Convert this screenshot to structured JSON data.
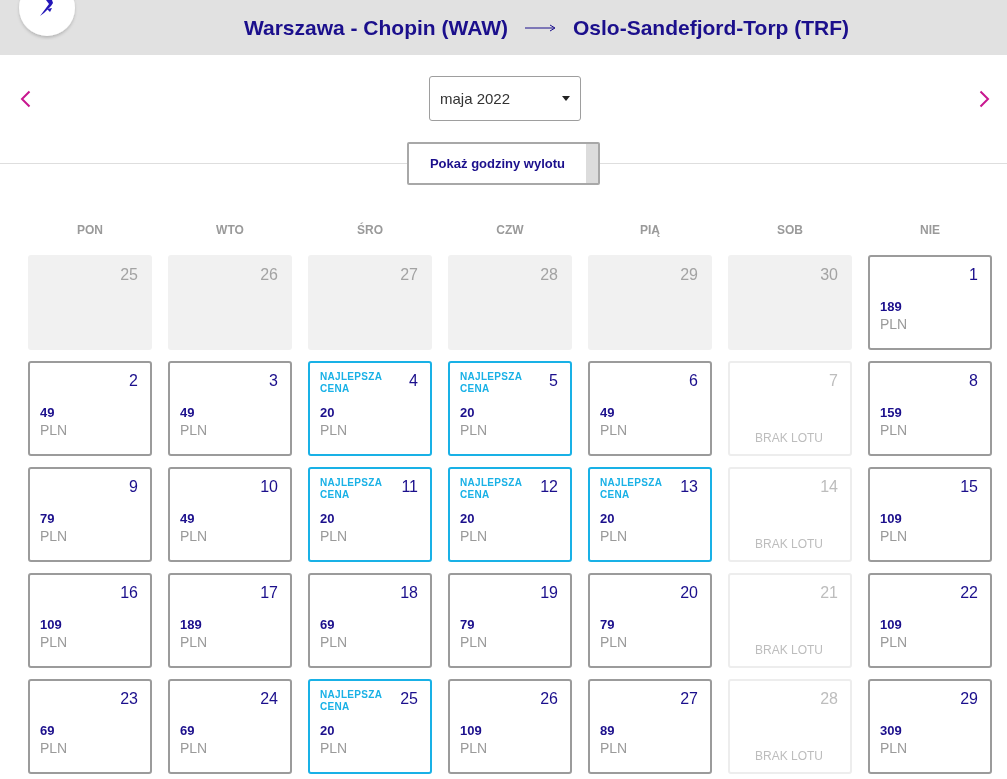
{
  "header": {
    "origin": "Warszawa - Chopin (WAW)",
    "destination": "Oslo-Sandefjord-Torp (TRF)"
  },
  "month_nav": {
    "month_select": {
      "value": "maja 2022"
    }
  },
  "show_times_button": {
    "label": "Pokaż godziny wylotu"
  },
  "calendar": {
    "weekdays": [
      "PON",
      "WTO",
      "ŚRO",
      "CZW",
      "PIĄ",
      "SOB",
      "NIE"
    ],
    "days": [
      {
        "kind": "outside",
        "date": "25"
      },
      {
        "kind": "outside",
        "date": "26"
      },
      {
        "kind": "outside",
        "date": "27"
      },
      {
        "kind": "outside",
        "date": "28"
      },
      {
        "kind": "outside",
        "date": "29"
      },
      {
        "kind": "outside",
        "date": "30"
      },
      {
        "kind": "available",
        "date": "1",
        "price": "189",
        "currency": "PLN"
      },
      {
        "kind": "available",
        "date": "2",
        "price": "49",
        "currency": "PLN"
      },
      {
        "kind": "available",
        "date": "3",
        "price": "49",
        "currency": "PLN"
      },
      {
        "kind": "best",
        "date": "4",
        "badge": "NAJLEPSZA CENA",
        "price": "20",
        "currency": "PLN"
      },
      {
        "kind": "best",
        "date": "5",
        "badge": "NAJLEPSZA CENA",
        "price": "20",
        "currency": "PLN"
      },
      {
        "kind": "available",
        "date": "6",
        "price": "49",
        "currency": "PLN"
      },
      {
        "kind": "no_flight",
        "date": "7",
        "note": "BRAK LOTU"
      },
      {
        "kind": "available",
        "date": "8",
        "price": "159",
        "currency": "PLN"
      },
      {
        "kind": "available",
        "date": "9",
        "price": "79",
        "currency": "PLN"
      },
      {
        "kind": "available",
        "date": "10",
        "price": "49",
        "currency": "PLN"
      },
      {
        "kind": "best",
        "date": "11",
        "badge": "NAJLEPSZA CENA",
        "price": "20",
        "currency": "PLN"
      },
      {
        "kind": "best",
        "date": "12",
        "badge": "NAJLEPSZA CENA",
        "price": "20",
        "currency": "PLN"
      },
      {
        "kind": "best",
        "date": "13",
        "badge": "NAJLEPSZA CENA",
        "price": "20",
        "currency": "PLN"
      },
      {
        "kind": "no_flight",
        "date": "14",
        "note": "BRAK LOTU"
      },
      {
        "kind": "available",
        "date": "15",
        "price": "109",
        "currency": "PLN"
      },
      {
        "kind": "available",
        "date": "16",
        "price": "109",
        "currency": "PLN"
      },
      {
        "kind": "available",
        "date": "17",
        "price": "189",
        "currency": "PLN"
      },
      {
        "kind": "available",
        "date": "18",
        "price": "69",
        "currency": "PLN"
      },
      {
        "kind": "available",
        "date": "19",
        "price": "79",
        "currency": "PLN"
      },
      {
        "kind": "available",
        "date": "20",
        "price": "79",
        "currency": "PLN"
      },
      {
        "kind": "no_flight",
        "date": "21",
        "note": "BRAK LOTU"
      },
      {
        "kind": "available",
        "date": "22",
        "price": "109",
        "currency": "PLN"
      },
      {
        "kind": "available",
        "date": "23",
        "price": "69",
        "currency": "PLN"
      },
      {
        "kind": "available",
        "date": "24",
        "price": "69",
        "currency": "PLN"
      },
      {
        "kind": "best",
        "date": "25",
        "badge": "NAJLEPSZA CENA",
        "price": "20",
        "currency": "PLN"
      },
      {
        "kind": "available",
        "date": "26",
        "price": "109",
        "currency": "PLN"
      },
      {
        "kind": "available",
        "date": "27",
        "price": "89",
        "currency": "PLN"
      },
      {
        "kind": "no_flight",
        "date": "28",
        "note": "BRAK LOTU"
      },
      {
        "kind": "available",
        "date": "29",
        "price": "309",
        "currency": "PLN"
      }
    ]
  }
}
